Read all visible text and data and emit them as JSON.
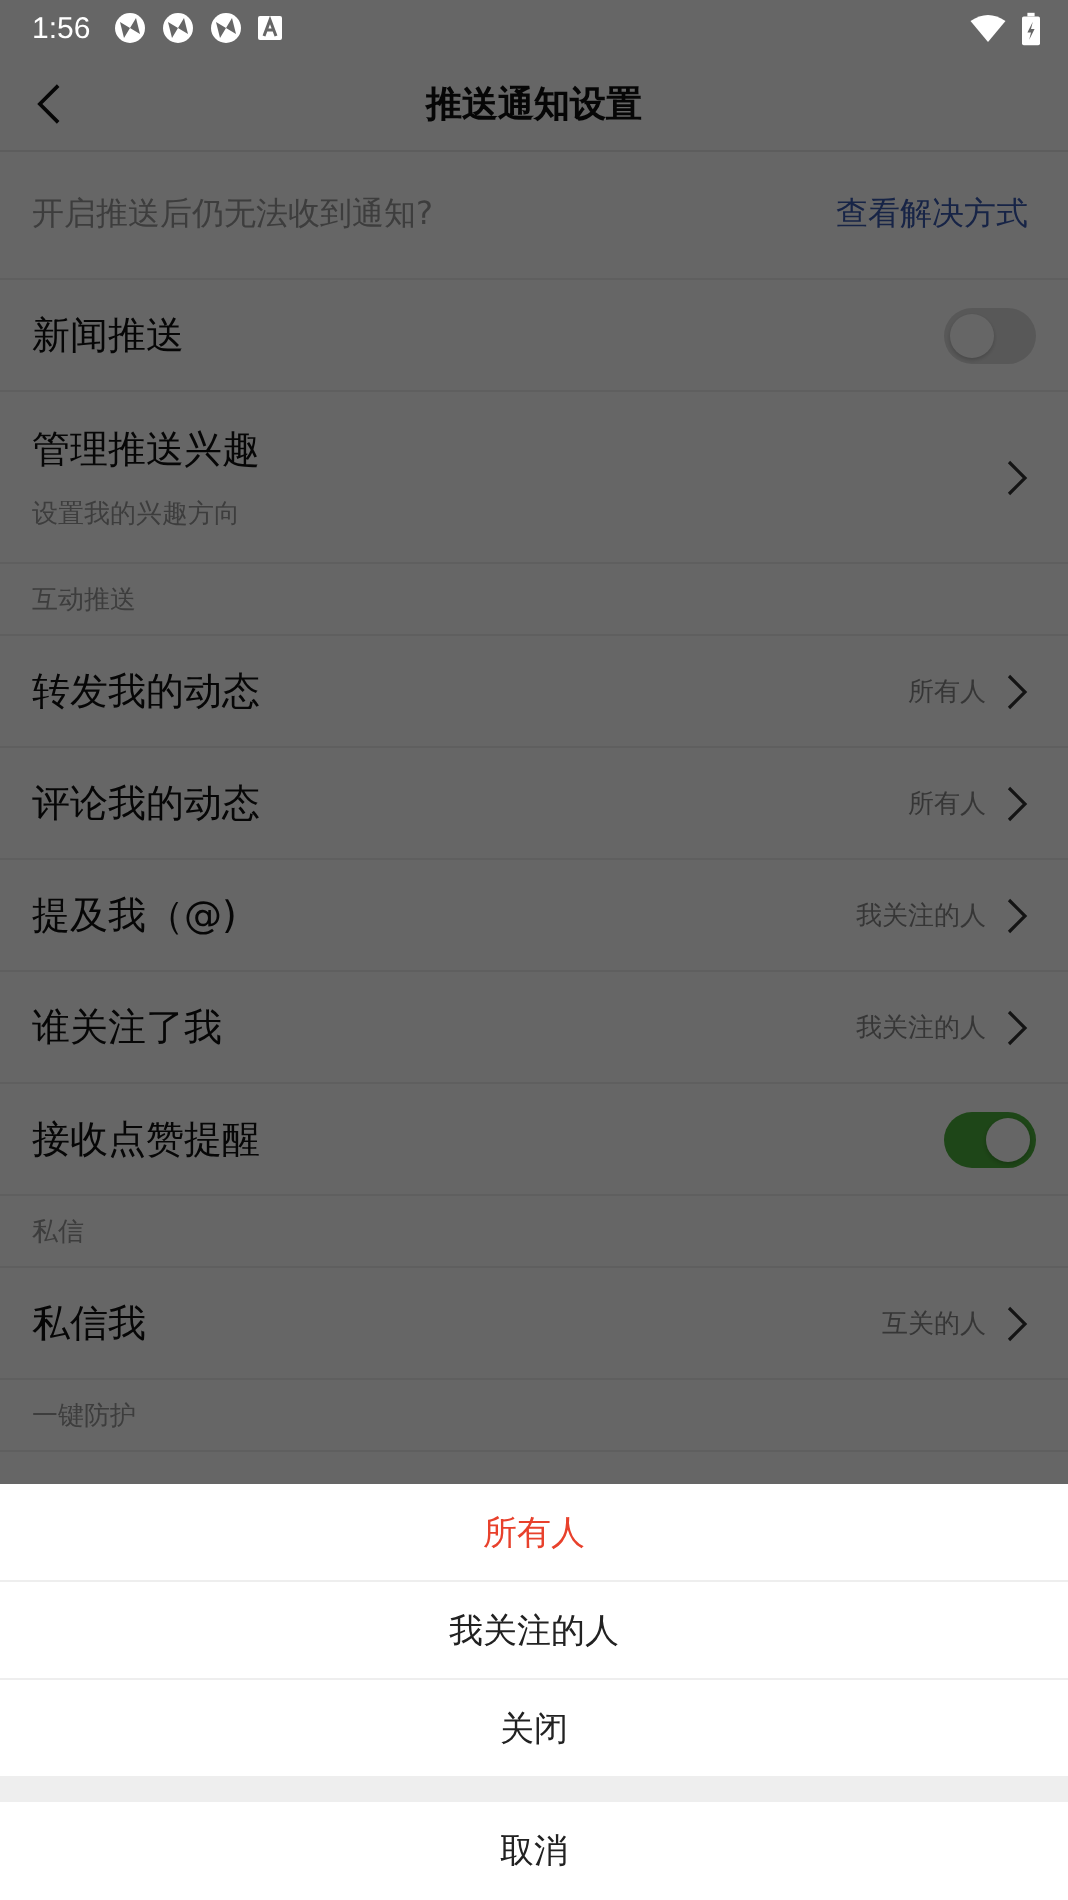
{
  "status_bar": {
    "time": "1:56"
  },
  "header": {
    "title": "推送通知设置"
  },
  "help": {
    "text": "开启推送后仍无法收到通知?",
    "link": "查看解决方式"
  },
  "items": [
    {
      "kind": "toggle",
      "label": "新闻推送",
      "on": false
    },
    {
      "kind": "nav",
      "label": "管理推送兴趣",
      "subtitle": "设置我的兴趣方向"
    },
    {
      "kind": "section",
      "label": "互动推送"
    },
    {
      "kind": "nav",
      "label": "转发我的动态",
      "value": "所有人"
    },
    {
      "kind": "nav",
      "label": "评论我的动态",
      "value": "所有人"
    },
    {
      "kind": "nav",
      "label": "提及我（@)",
      "value": "我关注的人"
    },
    {
      "kind": "nav",
      "label": "谁关注了我",
      "value": "我关注的人"
    },
    {
      "kind": "toggle",
      "label": "接收点赞提醒",
      "on": true
    },
    {
      "kind": "section",
      "label": "私信"
    },
    {
      "kind": "nav",
      "label": "私信我",
      "value": "互关的人"
    },
    {
      "kind": "section",
      "label": "一键防护"
    }
  ],
  "sheet": {
    "options": [
      {
        "label": "所有人",
        "selected": true
      },
      {
        "label": "我关注的人",
        "selected": false
      },
      {
        "label": "关闭",
        "selected": false
      }
    ],
    "cancel": "取消"
  }
}
